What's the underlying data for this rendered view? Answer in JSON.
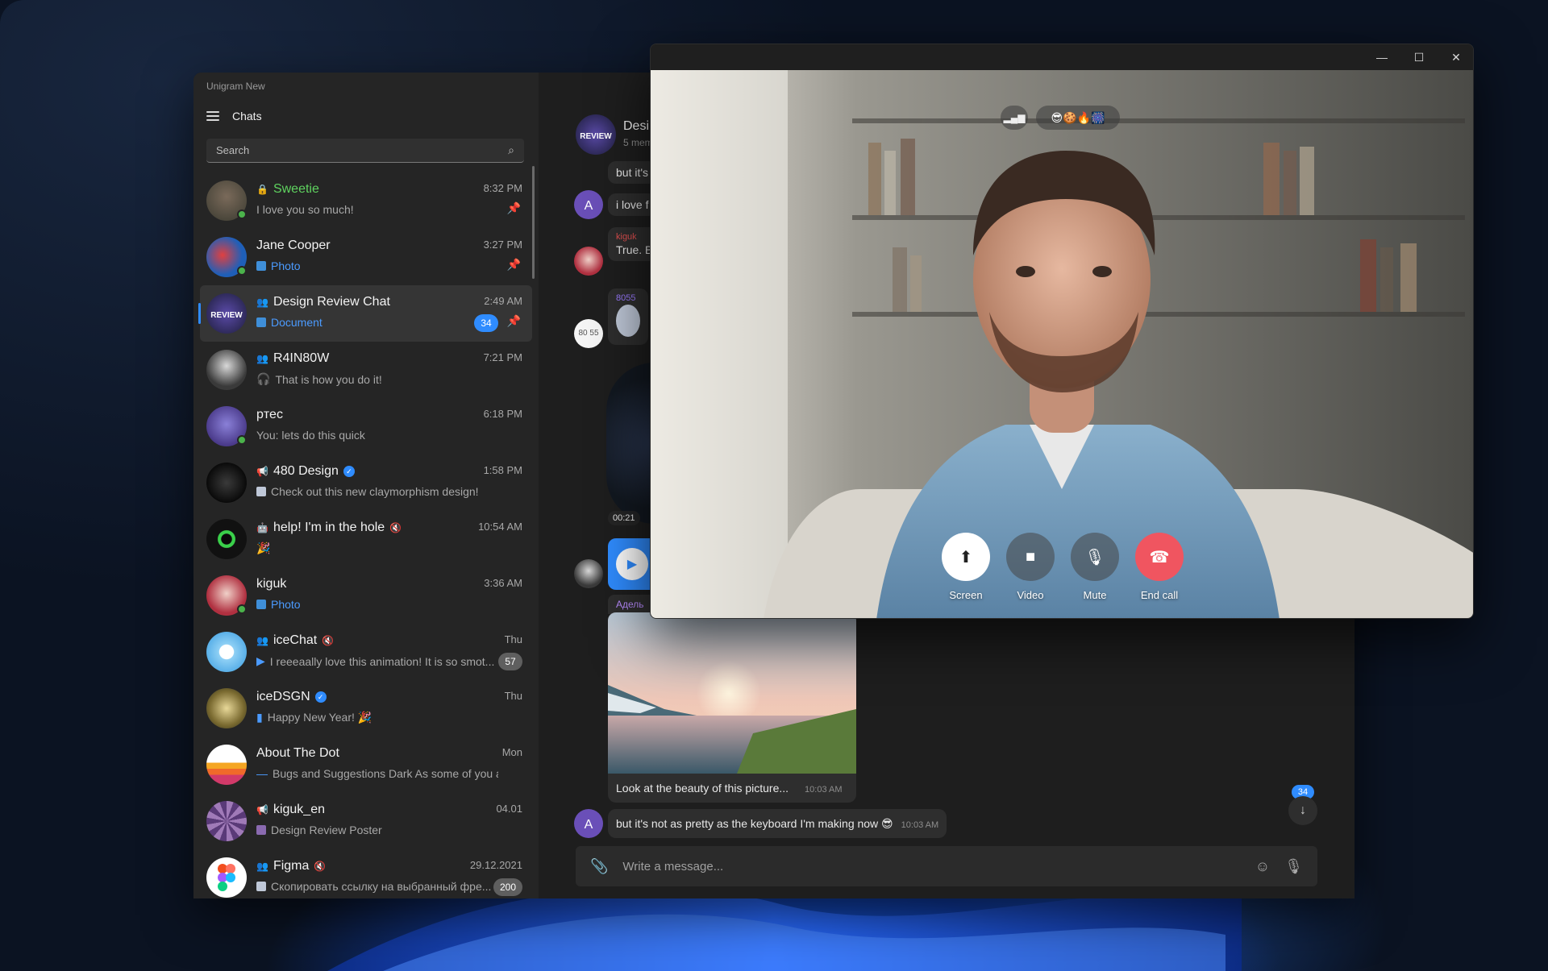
{
  "app": {
    "title": "Unigram New",
    "chats_label": "Chats",
    "search_placeholder": "Search"
  },
  "chats": [
    {
      "name": "Sweetie",
      "preview": "I love you so much!",
      "time": "8:32 PM",
      "pinned": true
    },
    {
      "name": "Jane Cooper",
      "preview": "Photo",
      "time": "3:27 PM",
      "pinned": true
    },
    {
      "name": "Design Review Chat",
      "preview": "Document",
      "time": "2:49 AM",
      "badge": "34",
      "pinned": true
    },
    {
      "name": "R4IN80W",
      "preview": "That is how you do it!",
      "time": "7:21 PM"
    },
    {
      "name": "pтес",
      "preview": "You: lets do this quick",
      "time": "6:18 PM"
    },
    {
      "name": "480 Design",
      "preview": "Check out this new claymorphism design!",
      "time": "1:58 PM"
    },
    {
      "name": "help! I'm in the hole",
      "preview": "🎉",
      "time": "10:54 AM"
    },
    {
      "name": "kiguk",
      "preview": "Photo",
      "time": "3:36 AM"
    },
    {
      "name": "iceChat",
      "preview": "I reeeaally love this animation! It is so smot...",
      "time": "Thu",
      "badge": "57"
    },
    {
      "name": "iceDSGN",
      "preview": "Happy New Year! 🎉",
      "time": "Thu"
    },
    {
      "name": "About The Dot",
      "preview": "Bugs and Suggestions Dark As some of you are ...",
      "time": "Mon"
    },
    {
      "name": "kiguk_en",
      "preview": "Design Review Poster",
      "time": "04.01"
    },
    {
      "name": "Figma",
      "preview": "Скопировать ссылку на выбранный фре...",
      "time": "29.12.2021",
      "badge": "200"
    }
  ],
  "conversation": {
    "title": "Desi",
    "subtitle": "5 mem",
    "messages": [
      {
        "text": "but it's"
      },
      {
        "text": "i love f"
      },
      {
        "sender": "kiguk",
        "text": "True. B"
      },
      {
        "sender": "8055"
      },
      {
        "sender_initials": "80 55"
      },
      {
        "duration": "00:21"
      },
      {
        "sender": "Адель"
      },
      {
        "text": "Look at the beauty of this picture...",
        "time": "10:03 AM"
      },
      {
        "text": "but it's not as pretty as the keyboard I'm making now 😎",
        "time": "10:03 AM"
      }
    ],
    "composer_placeholder": "Write a message...",
    "unread_badge": "34"
  },
  "call": {
    "emojis": "😎🍪🔥🎆",
    "controls": {
      "screen": "Screen",
      "video": "Video",
      "mute": "Mute",
      "end": "End call"
    }
  },
  "colors": {
    "accent": "#2f8cff",
    "online": "#4bb34b",
    "end_call": "#f05560"
  }
}
